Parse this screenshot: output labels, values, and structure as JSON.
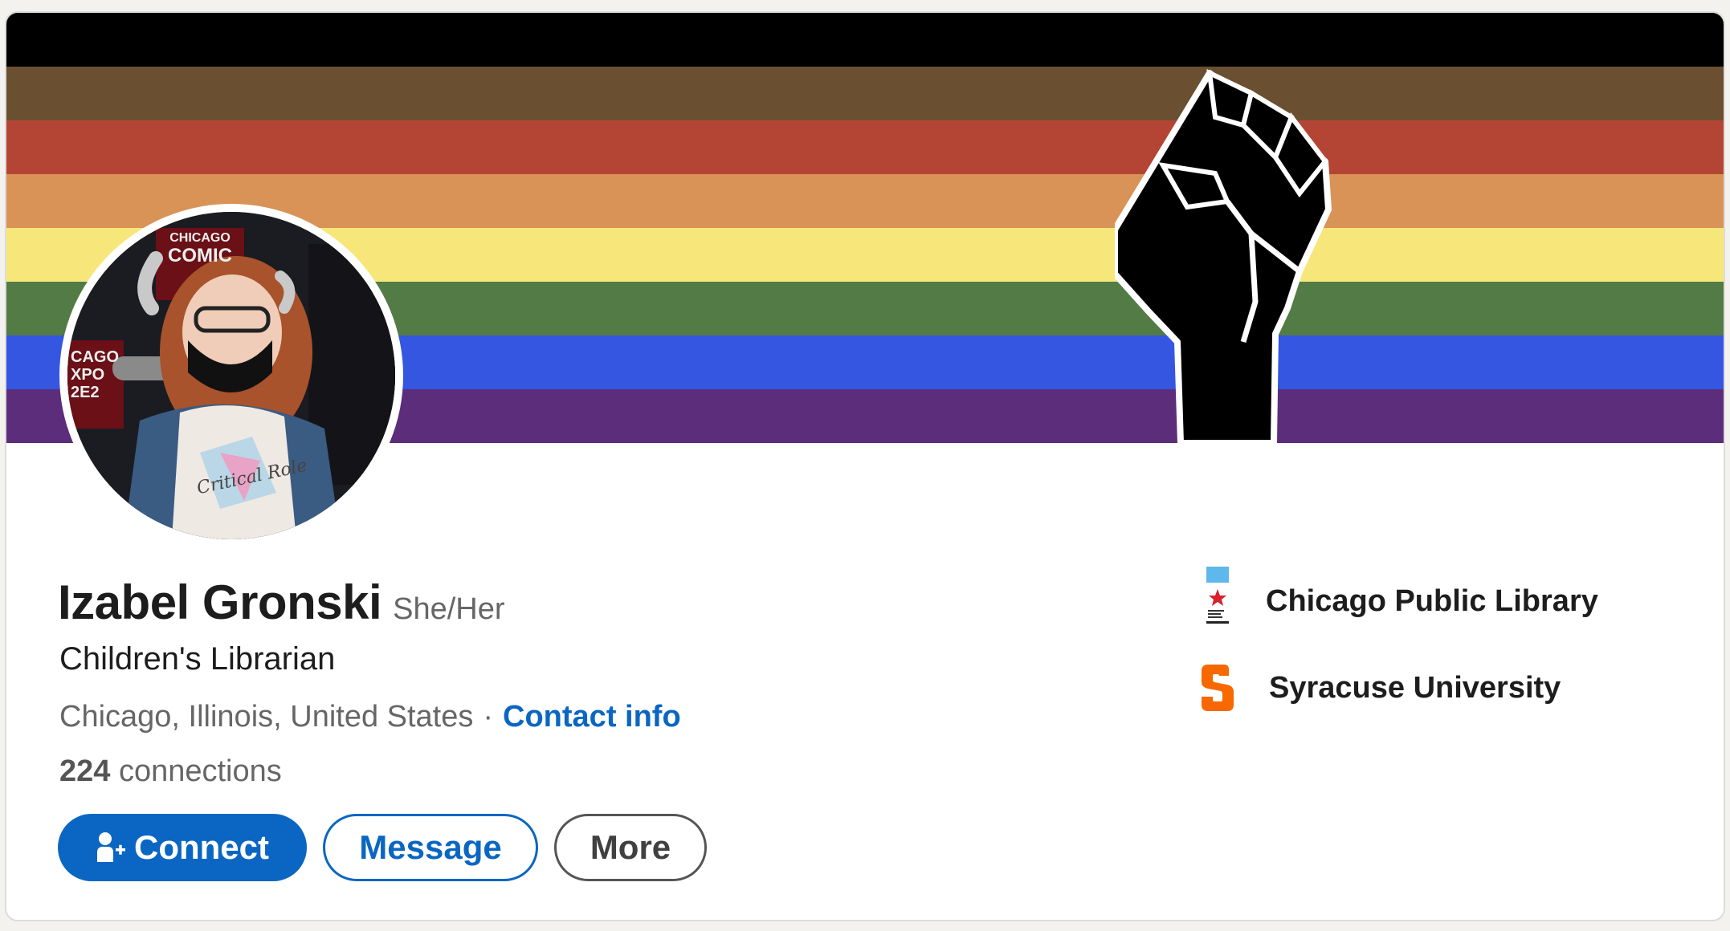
{
  "profile": {
    "name": "Izabel Gronski",
    "pronouns": "She/Her",
    "headline": "Children's Librarian",
    "location": "Chicago, Illinois, United States",
    "separator": "·",
    "contact_info": "Contact info",
    "connections_count": "224",
    "connections_label": "connections"
  },
  "actions": {
    "connect": "Connect",
    "message": "Message",
    "more": "More"
  },
  "organizations": [
    {
      "name": "Chicago Public Library",
      "icon": "chicago-public-library-logo"
    },
    {
      "name": "Syracuse University",
      "icon": "syracuse-university-logo"
    }
  ],
  "avatar_photo_text": {
    "sign_line_1": "CHICAGO",
    "sign_line_2": "COMIC",
    "side_text": "CAGO XPO 2E2",
    "shirt_text": "Critical Role"
  },
  "banner": {
    "stripe_colors": [
      "#000000",
      "#6b4f31",
      "#b44534",
      "#d99356",
      "#f7e77b",
      "#537b45",
      "#3456e0",
      "#5b2d7a"
    ],
    "icon": "raised-fist"
  },
  "colors": {
    "primary": "#0a66c2",
    "text": "#1d1d1d",
    "muted": "#666666"
  }
}
